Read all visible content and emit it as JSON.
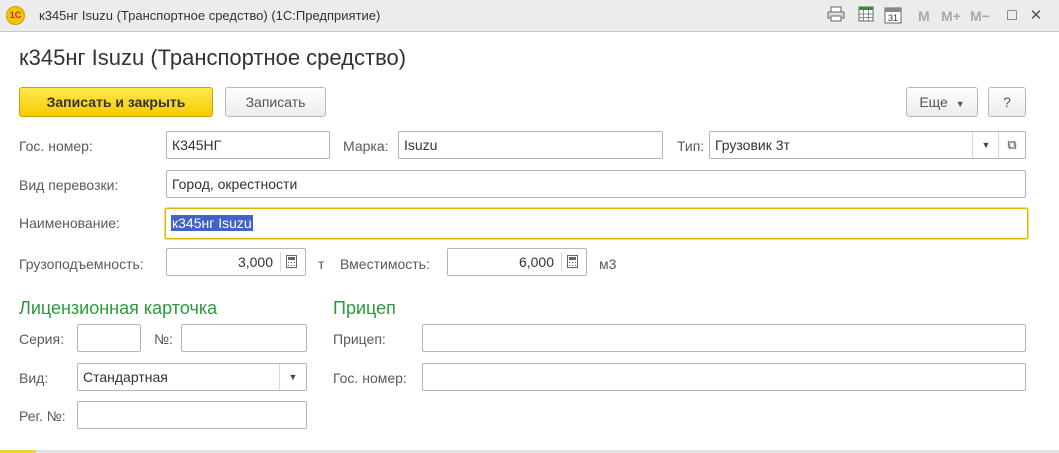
{
  "window": {
    "title": "к345нг Isuzu (Транспортное средство)  (1С:Предприятие)",
    "logo_text": "1С",
    "toolbar_icons": [
      "printer-icon",
      "spreadsheet-icon",
      "calendar-icon"
    ],
    "calendar_day": "31",
    "memory_buttons": [
      "M",
      "M+",
      "M−"
    ],
    "controls": {
      "maximize": "□",
      "close": "✕"
    }
  },
  "form": {
    "title": "к345нг Isuzu (Транспортное средство)",
    "buttons": {
      "save_close": "Записать и закрыть",
      "save": "Записать",
      "more": "Еще",
      "help": "?"
    }
  },
  "fields": {
    "gos_nomer": {
      "label": "Гос. номер:",
      "value": "К345НГ"
    },
    "marka": {
      "label": "Марка:",
      "value": "Isuzu"
    },
    "tip": {
      "label": "Тип:",
      "value": "Грузовик 3т"
    },
    "vid_perevozki": {
      "label": "Вид перевозки:",
      "value": "Город, окрестности"
    },
    "naimenovanie": {
      "label": "Наименование:",
      "value": "к345нг Isuzu"
    },
    "gruzopodemnost": {
      "label": "Грузоподъемность:",
      "value": "3,000",
      "unit": "т"
    },
    "vmestimost": {
      "label": "Вместимость:",
      "value": "6,000",
      "unit": "м3"
    }
  },
  "license_card": {
    "title": "Лицензионная карточка",
    "seriya": {
      "label": "Серия:",
      "value": ""
    },
    "nomer": {
      "label": "№:",
      "value": ""
    },
    "vid": {
      "label": "Вид:",
      "value": "Стандартная"
    },
    "reg_nomer": {
      "label": "Рег. №:",
      "value": ""
    }
  },
  "trailer": {
    "title": "Прицеп",
    "pricep": {
      "label": "Прицеп:",
      "value": ""
    },
    "gos_nomer": {
      "label": "Гос. номер:",
      "value": ""
    }
  },
  "colors": {
    "accent_yellow": "#f3cc00",
    "section_green": "#2a9a3c",
    "selection_blue": "#3f63c7"
  }
}
